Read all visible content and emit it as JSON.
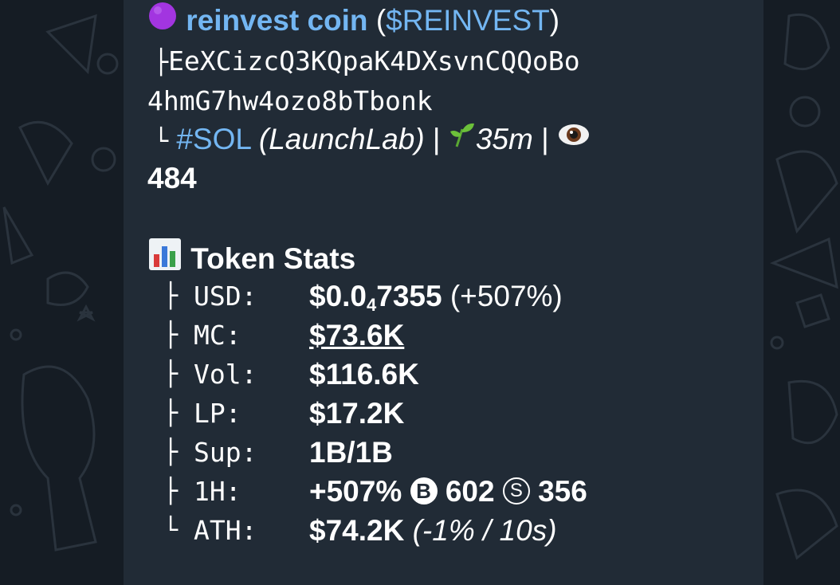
{
  "header": {
    "coin_name": "reinvest coin",
    "ticker_open": "(",
    "ticker": "$REINVEST",
    "ticker_close": ")",
    "address_line1": "EeXCizcQ3KQpaK4DXsvnCQQoBo",
    "address_line2": "4hmG7hw4ozo8bTbonk",
    "chain_tag": "#SOL",
    "launchpad": "(LaunchLab)",
    "sep1": "|",
    "age": "35m",
    "sep2": "|",
    "views": "484"
  },
  "stats": {
    "title": "Token Stats",
    "rows": [
      {
        "label": "USD:",
        "value_main": "$0.0",
        "value_sub": "4",
        "value_rest": "7355",
        "value_extra": " (+507%)"
      },
      {
        "label": "MC:",
        "value": "$73.6K"
      },
      {
        "label": "Vol:",
        "value": "$116.6K"
      },
      {
        "label": "LP:",
        "value": "$17.2K"
      },
      {
        "label": "Sup:",
        "value": "1B/1B"
      },
      {
        "label": "1H:",
        "change": "+507%",
        "buy_icon": "B",
        "buys": "602",
        "sell_icon": "S",
        "sells": "356"
      },
      {
        "label": "ATH:",
        "value": "$74.2K",
        "note": "(-1% / 10s)"
      }
    ]
  },
  "colors": {
    "background": "#151c24",
    "bubble": "#212b36",
    "link": "#73b6f2",
    "text": "#ffffff"
  },
  "icons": [
    "purple-circle-icon",
    "seedling-icon",
    "eye-icon",
    "bar-chart-icon",
    "buy-circle-icon",
    "sell-circle-icon"
  ]
}
